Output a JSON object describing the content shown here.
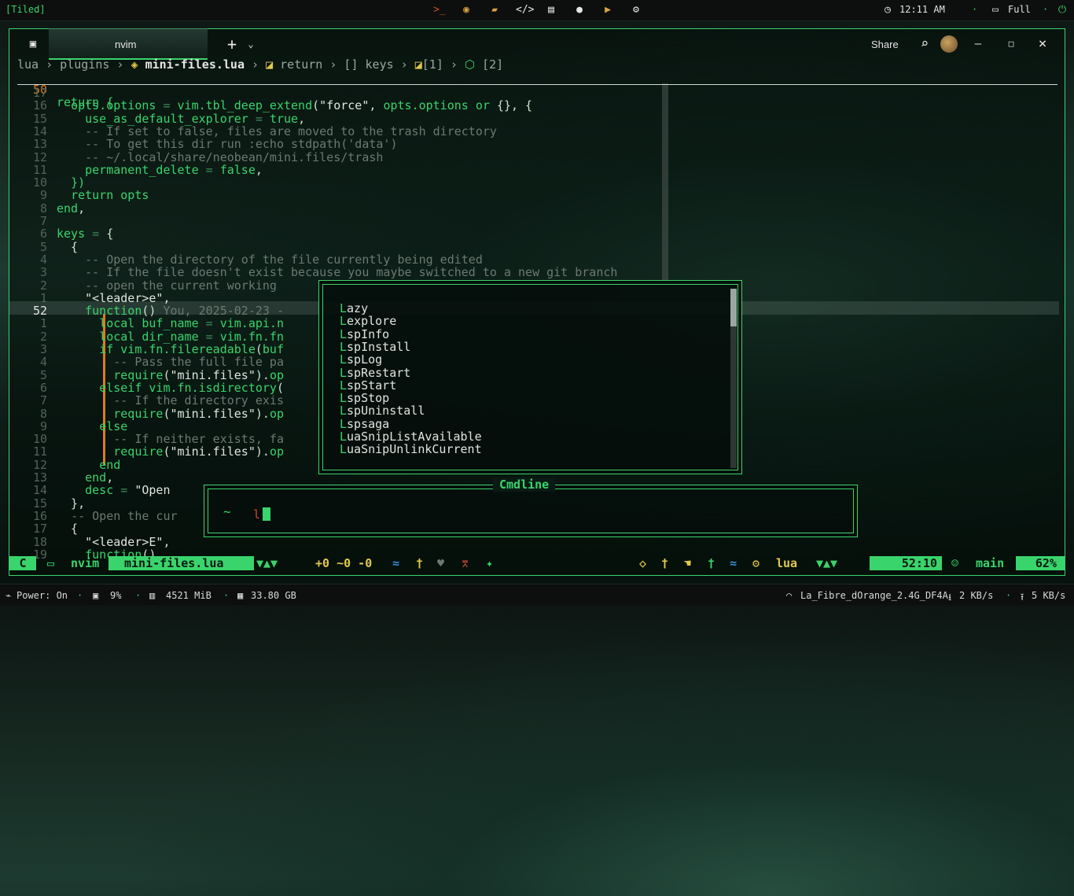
{
  "topbar": {
    "workspace_mode": "[Tiled]",
    "icons": [
      "terminal-icon",
      "firefox-icon",
      "folder-icon",
      "code-icon",
      "book-icon",
      "chat-icon",
      "youtube-icon",
      "gear-icon"
    ],
    "clock": "12:11 AM",
    "battery": "Full",
    "accent": "#3ad46c"
  },
  "window": {
    "tab_title": "nvim",
    "new_tab": "+",
    "tab_dropdown": "⌄",
    "share_label": "Share",
    "minimize": "–",
    "maximize": "□",
    "close": "×"
  },
  "breadcrumb": {
    "segments": [
      "lua",
      "plugins",
      "mini-files.lua",
      "return",
      "[] keys",
      "[1]",
      "[2]"
    ],
    "text_dir": "lua › plugins › ",
    "file": "mini-files.lua",
    "rest_1": " › ",
    "rest_2": "return",
    "rest_3": " › [] keys › ",
    "rest_4": "[1]",
    "rest_5": " › ",
    "rest_6": "[2]"
  },
  "editor": {
    "sticky": {
      "ln": "50",
      "code": "return {"
    },
    "lines": [
      {
        "ln": "17",
        "html": ""
      },
      {
        "ln": "16",
        "html": "  <span class=\"id\">opts.options</span> <span class=\"op\">=</span> <span class=\"id\">vim.tbl_deep_extend</span>(<span class=\"str\">\"force\"</span>, <span class=\"id\">opts.options</span> <span class=\"kw\">or</span> {}, {"
      },
      {
        "ln": "15",
        "html": "    <span class=\"id\">use_as_default_explorer</span> <span class=\"op\">=</span> <span class=\"bool\">true</span>,"
      },
      {
        "ln": "14",
        "html": "    <span class=\"cm\">-- If set to false, files are moved to the trash directory</span>"
      },
      {
        "ln": "13",
        "html": "    <span class=\"cm\">-- To get this dir run :echo stdpath('data')</span>"
      },
      {
        "ln": "12",
        "html": "    <span class=\"cm\">-- ~/.local/share/neobean/mini.files/trash</span>"
      },
      {
        "ln": "11",
        "html": "    <span class=\"id\">permanent_delete</span> <span class=\"op\">=</span> <span class=\"bool\">false</span>,"
      },
      {
        "ln": "10",
        "html": "  <span class=\"kw\">})</span>"
      },
      {
        "ln": "9",
        "html": "  <span class=\"kw\">return</span> <span class=\"id\">opts</span>"
      },
      {
        "ln": "8",
        "html": "<span class=\"kw\">end</span>,"
      },
      {
        "ln": "7",
        "html": ""
      },
      {
        "ln": "6",
        "html": "<span class=\"id\">keys</span> <span class=\"op\">=</span> {"
      },
      {
        "ln": "5",
        "html": "  {"
      },
      {
        "ln": "4",
        "html": "    <span class=\"cm\">-- Open the directory of the file currently being edited</span>"
      },
      {
        "ln": "3",
        "html": "    <span class=\"cm\">-- If the file doesn't exist because you maybe switched to a new git branch</span>"
      },
      {
        "ln": "2",
        "html": "    <span class=\"cm\">-- open the current working</span>"
      },
      {
        "ln": "1",
        "html": "    <span class=\"str\">\"&lt;leader&gt;e\"</span>,"
      },
      {
        "ln": "52",
        "html": "    <span class=\"kw\">function</span>() <span class=\"cm\">You, 2025-02-23 -</span>",
        "current": true
      },
      {
        "ln": "1",
        "html": "      <span class=\"kw\">local</span> <span class=\"id\">buf_name</span> <span class=\"op\">=</span> <span class=\"id\">vim.api.n</span>"
      },
      {
        "ln": "2",
        "html": "      <span class=\"kw\">local</span> <span class=\"id\">dir_name</span> <span class=\"op\">=</span> <span class=\"id\">vim.fn.fn</span>"
      },
      {
        "ln": "3",
        "html": "      <span class=\"kw\">if</span> <span class=\"id\">vim.fn.filereadable</span>(<span class=\"id\">buf</span>"
      },
      {
        "ln": "4",
        "html": "        <span class=\"cm\">-- Pass the full file pa</span>"
      },
      {
        "ln": "5",
        "html": "        <span class=\"id\">require</span>(<span class=\"str\">\"mini.files\"</span>).<span class=\"id\">op</span>"
      },
      {
        "ln": "6",
        "html": "      <span class=\"kw\">elseif</span> <span class=\"id\">vim.fn.isdirectory</span>("
      },
      {
        "ln": "7",
        "html": "        <span class=\"cm\">-- If the directory exis</span>"
      },
      {
        "ln": "8",
        "html": "        <span class=\"id\">require</span>(<span class=\"str\">\"mini.files\"</span>).<span class=\"id\">op</span>"
      },
      {
        "ln": "9",
        "html": "      <span class=\"kw\">else</span>"
      },
      {
        "ln": "10",
        "html": "        <span class=\"cm\">-- If neither exists, fa</span>"
      },
      {
        "ln": "11",
        "html": "        <span class=\"id\">require</span>(<span class=\"str\">\"mini.files\"</span>).<span class=\"id\">op</span>"
      },
      {
        "ln": "12",
        "html": "      <span class=\"kw\">end</span>"
      },
      {
        "ln": "13",
        "html": "    <span class=\"kw\">end</span>,"
      },
      {
        "ln": "14",
        "html": "    <span class=\"id\">desc</span> <span class=\"op\">=</span> <span class=\"str\">\"Open</span>"
      },
      {
        "ln": "15",
        "html": "  },"
      },
      {
        "ln": "16",
        "html": "  <span class=\"cm\">-- Open the cur</span>"
      },
      {
        "ln": "17",
        "html": "  {"
      },
      {
        "ln": "18",
        "html": "    <span class=\"str\">\"&lt;leader&gt;E\"</span>,"
      },
      {
        "ln": "19",
        "html": "    <span class=\"kw\">function</span>()"
      }
    ]
  },
  "completion": {
    "items": [
      "Lazy",
      "Lexplore",
      "LspInfo",
      "LspInstall",
      "LspLog",
      "LspRestart",
      "LspStart",
      "LspStop",
      "LspUninstall",
      "Lspsaga",
      "LuaSnipListAvailable",
      "LuaSnipUnlinkCurrent"
    ]
  },
  "cmdline": {
    "title": "Cmdline",
    "icon": "kali-dragon-icon",
    "input": "l"
  },
  "statusline": {
    "mode": "C",
    "dir_icon": "folder-icon",
    "dir": "nvim",
    "file": "mini-files.lua",
    "git_diff": "+0 ~0 -0",
    "lang": "lua",
    "position": "52:10",
    "branch": "main",
    "percent": "62%"
  },
  "bottombar": {
    "power": "Power: On",
    "cpu": "9%",
    "mem": "4521 MiB",
    "disk": "33.80 GB",
    "wifi": "La_Fibre_dOrange_2.4G_DF4A",
    "down": "2 KB/s",
    "up": "5 KB/s"
  }
}
